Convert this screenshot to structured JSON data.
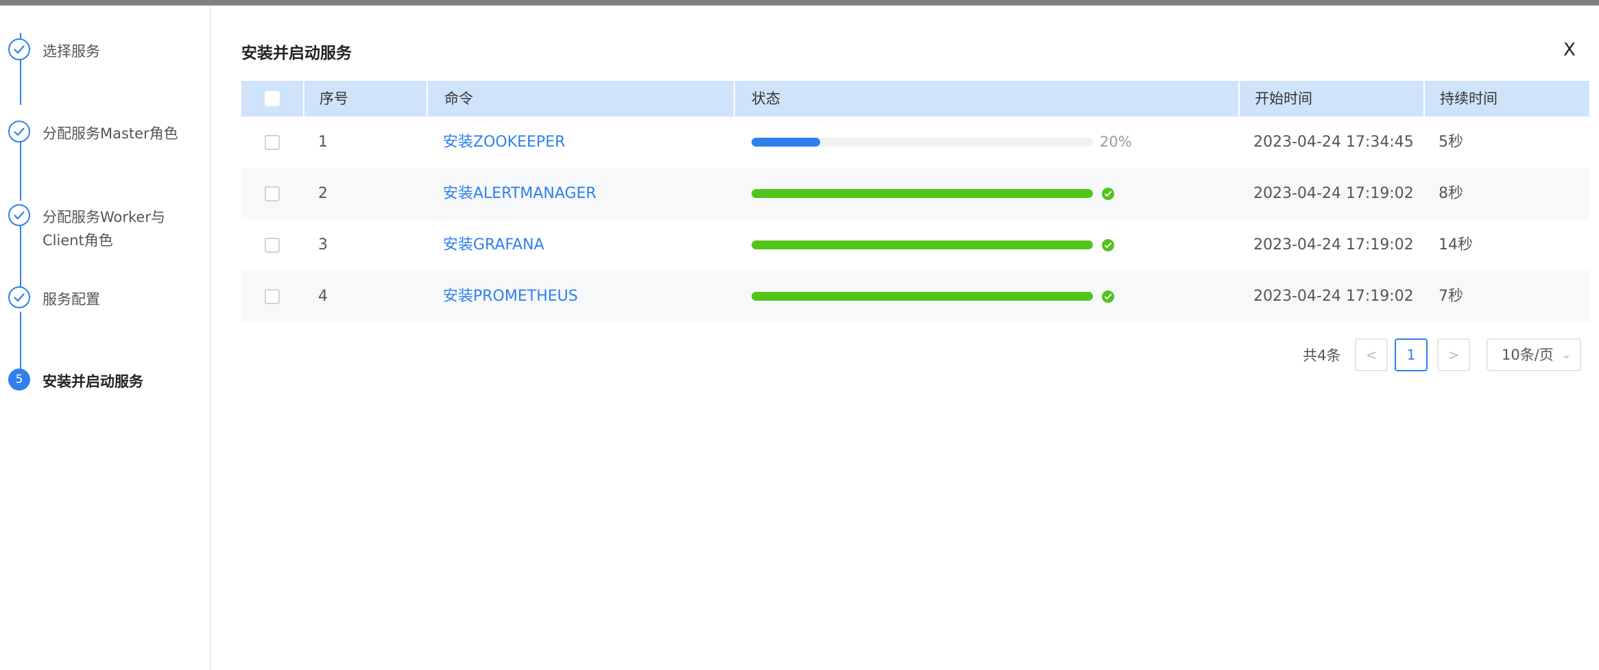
{
  "steps": [
    {
      "label": "选择服务",
      "state": "done"
    },
    {
      "label": "分配服务Master角色",
      "state": "done"
    },
    {
      "label": "分配服务Worker与Client角色",
      "state": "done"
    },
    {
      "label": "服务配置",
      "state": "done"
    },
    {
      "label": "安装并启动服务",
      "state": "active",
      "number": "5"
    }
  ],
  "dialog": {
    "title": "安装并启动服务",
    "close_label": "X"
  },
  "table": {
    "columns": [
      "序号",
      "命令",
      "状态",
      "开始时间",
      "持续时间"
    ],
    "rows": [
      {
        "index": "1",
        "command": "安装ZOOKEEPER",
        "progress": 0.2,
        "progress_label": "20%",
        "status": "running",
        "start_time": "2023-04-24 17:34:45",
        "duration": "5秒"
      },
      {
        "index": "2",
        "command": "安装ALERTMANAGER",
        "progress": 1.0,
        "progress_label": "",
        "status": "success",
        "start_time": "2023-04-24 17:19:02",
        "duration": "8秒"
      },
      {
        "index": "3",
        "command": "安装GRAFANA",
        "progress": 1.0,
        "progress_label": "",
        "status": "success",
        "start_time": "2023-04-24 17:19:02",
        "duration": "14秒"
      },
      {
        "index": "4",
        "command": "安装PROMETHEUS",
        "progress": 1.0,
        "progress_label": "",
        "status": "success",
        "start_time": "2023-04-24 17:19:02",
        "duration": "7秒"
      }
    ]
  },
  "pagination": {
    "total_label": "共4条",
    "prev": "<",
    "current_page": "1",
    "next": ">",
    "page_size": "10条/页"
  },
  "colors": {
    "accent": "#2f80ed",
    "success": "#52c41a",
    "header_bg": "#cfe3fb"
  }
}
